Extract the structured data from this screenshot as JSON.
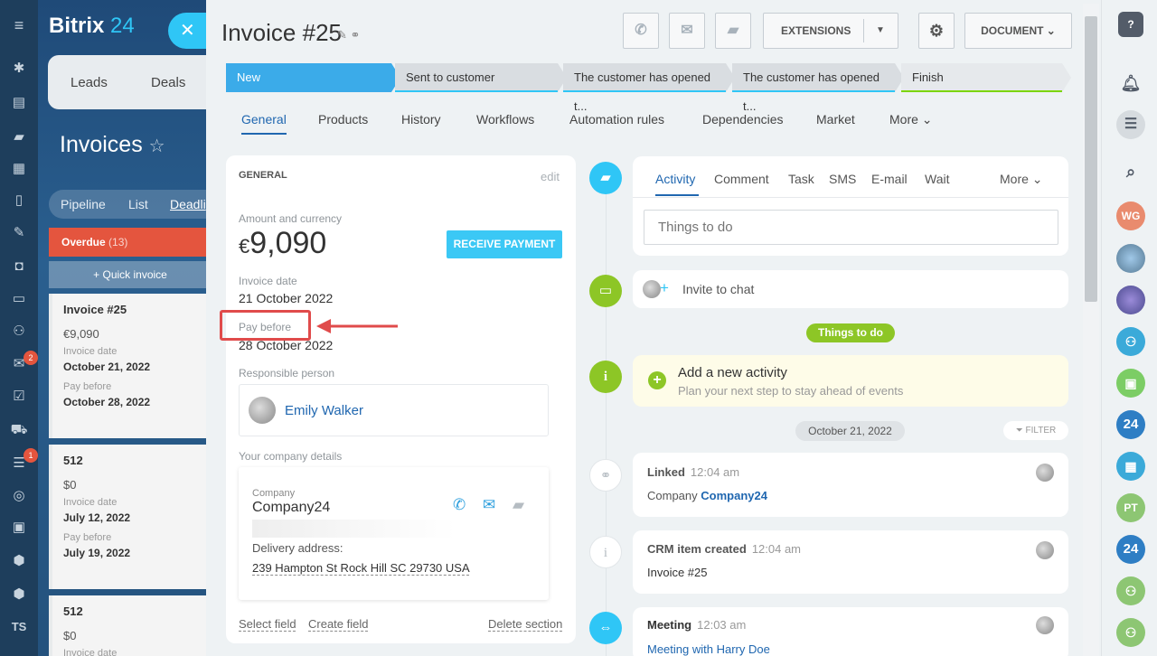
{
  "crm": {
    "logo_a": "Bitrix",
    "logo_b": "24",
    "tab_leads": "Leads",
    "tab_deals": "Deals",
    "page_title": "Invoices",
    "view_pipeline": "Pipeline",
    "view_list": "List",
    "view_deadlines": "Deadli",
    "overdue": "Overdue",
    "overdue_count": "(13)",
    "quick_invoice": "+ Quick invoice",
    "cards": [
      {
        "title": "Invoice #25",
        "value": "€9,090",
        "date_label": "Invoice date",
        "date": "October 21, 2022",
        "pay_label": "Pay before",
        "pay": "October 28, 2022"
      },
      {
        "title": "512",
        "value": "$0",
        "date_label": "Invoice date",
        "date": "July 12, 2022",
        "pay_label": "Pay before",
        "pay": "July 19, 2022"
      },
      {
        "title": "512",
        "value": "$0",
        "date_label": "Invoice date"
      }
    ]
  },
  "leftnav": {
    "badge_mail": "2",
    "badge_filter": "1",
    "initials": "TS"
  },
  "invoice": {
    "title": "Invoice #25",
    "extensions": "EXTENSIONS",
    "document": "DOCUMENT",
    "stages": [
      "New",
      "Sent to customer",
      "The customer has opened t...",
      "The customer has opened t...",
      "Finish"
    ],
    "stage_colors": [
      "#3babe9",
      "#d9dde1",
      "#d9dde1",
      "#d9dde1",
      "#e6e9ec"
    ],
    "tabs": [
      "General",
      "Products",
      "History",
      "Workflows",
      "Automation rules",
      "Dependencies",
      "Market",
      "More"
    ]
  },
  "general": {
    "header": "GENERAL",
    "edit": "edit",
    "amount_label": "Amount and currency",
    "currency": "€",
    "amount": "9,090",
    "receive_payment": "RECEIVE PAYMENT",
    "invoice_date_label": "Invoice date",
    "invoice_date": "21 October 2022",
    "pay_before_label": "Pay before",
    "pay_before": "28 October 2022",
    "responsible_label": "Responsible person",
    "responsible": "Emily Walker",
    "company_details_label": "Your company details",
    "company_label": "Company",
    "company": "Company24",
    "delivery_label": "Delivery address:",
    "delivery": "239 Hampton St Rock Hill SC 29730 USA",
    "select_field": "Select field",
    "create_field": "Create field",
    "delete_section": "Delete section"
  },
  "timeline": {
    "tabs": [
      "Activity",
      "Comment",
      "Task",
      "SMS",
      "E-mail",
      "Wait"
    ],
    "more": "More",
    "todo_placeholder": "Things to do",
    "invite": "Invite to chat",
    "things_badge": "Things to do",
    "add_title": "Add a new activity",
    "add_sub": "Plan your next step to stay ahead of events",
    "date_pill": "October 21, 2022",
    "filter": "FILTER",
    "items": [
      {
        "title": "Linked",
        "time": "12:04 am",
        "prefix": "Company",
        "body": "Company24"
      },
      {
        "title": "CRM item created",
        "time": "12:04 am",
        "body": "Invoice #25"
      },
      {
        "title": "Meeting",
        "time": "12:03 am",
        "body": "Meeting with Harry Doe"
      }
    ]
  },
  "rightnav": {
    "help": "?",
    "u1": "WG",
    "u2": "PT",
    "n24": "24"
  }
}
